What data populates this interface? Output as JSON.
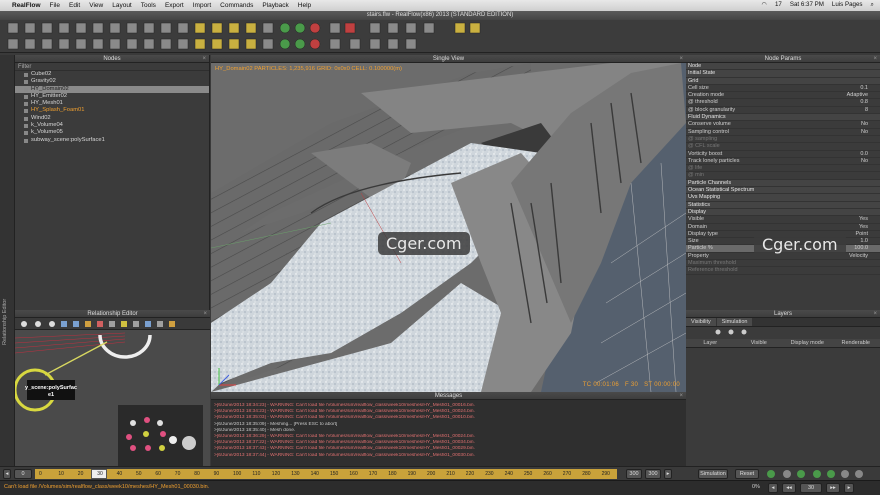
{
  "menubar": {
    "app_name": "RealFlow",
    "items": [
      "File",
      "Edit",
      "View",
      "Layout",
      "Tools",
      "Export",
      "Import",
      "Commands",
      "Playback",
      "Help"
    ],
    "clock": "Sat 6:37 PM",
    "user": "Luis Pages",
    "battery": "17"
  },
  "window": {
    "title": "stairs.flw - RealFlow(x86) 2013 (STANDARD EDITION)"
  },
  "nodes_panel": {
    "title": "Nodes",
    "filter_label": "Filter",
    "items": [
      {
        "label": "Cube02",
        "state": "normal"
      },
      {
        "label": "Gravity02",
        "state": "normal"
      },
      {
        "label": "HY_Domain02",
        "state": "selected"
      },
      {
        "label": "HY_Emitter02",
        "state": "normal"
      },
      {
        "label": "HY_Mesh01",
        "state": "normal"
      },
      {
        "label": "HY_Splash_Foam01",
        "state": "orange"
      },
      {
        "label": "Wind02",
        "state": "normal"
      },
      {
        "label": "k_Volume04",
        "state": "normal"
      },
      {
        "label": "k_Volume05",
        "state": "normal"
      },
      {
        "label": "subway_scene:polySurface1",
        "state": "normal"
      }
    ]
  },
  "side_label": "Relationship Editor",
  "relationship_panel": {
    "title": "Relationship Editor",
    "node_label": "y_scene:polySurfac e1"
  },
  "view_panel": {
    "title": "Single View",
    "stats": "HY_Domain02 PARTICLES: 1,235,916 GRID: 0x0x0 CELL: 0.100000(m)",
    "timecode": "TC 00:01:06",
    "frame": "F 30",
    "step_time": "ST 00:00:00",
    "watermark": "Cger.com"
  },
  "node_params": {
    "title": "Node Params",
    "rows": [
      {
        "label": "Node",
        "value": "",
        "type": "sec"
      },
      {
        "label": "Initial State",
        "value": "",
        "type": "sec"
      },
      {
        "label": "Grid",
        "value": "",
        "type": "sec"
      },
      {
        "label": "Cell size",
        "value": "0.1",
        "type": "row"
      },
      {
        "label": "Creation mode",
        "value": "Adaptive",
        "type": "row"
      },
      {
        "label": "@ threshold",
        "value": "0.8",
        "type": "row"
      },
      {
        "label": "@ block granularity",
        "value": "8",
        "type": "row"
      },
      {
        "label": "Fluid Dynamics",
        "value": "",
        "type": "sec"
      },
      {
        "label": "Conserve volume",
        "value": "No",
        "type": "row"
      },
      {
        "label": "Sampling control",
        "value": "No",
        "type": "row"
      },
      {
        "label": "@ sampling",
        "value": "",
        "type": "dim"
      },
      {
        "label": "@ CFL scale",
        "value": "",
        "type": "dim"
      },
      {
        "label": "Vorticity boost",
        "value": "0.0",
        "type": "row"
      },
      {
        "label": "Track lonely particles",
        "value": "No",
        "type": "row"
      },
      {
        "label": "@ life",
        "value": "",
        "type": "dim"
      },
      {
        "label": "@ min",
        "value": "",
        "type": "dim"
      },
      {
        "label": "Particle Channels",
        "value": "",
        "type": "sec"
      },
      {
        "label": "Ocean Statistical Spectrum",
        "value": "",
        "type": "sec"
      },
      {
        "label": "Uvs Mapping",
        "value": "",
        "type": "sec"
      },
      {
        "label": "Statistics",
        "value": "",
        "type": "sec"
      },
      {
        "label": "Display",
        "value": "",
        "type": "sec"
      },
      {
        "label": "Visible",
        "value": "Yes",
        "type": "row"
      },
      {
        "label": "Domain",
        "value": "Yes",
        "type": "row"
      },
      {
        "label": "Display type",
        "value": "Point",
        "type": "row"
      },
      {
        "label": "Size",
        "value": "1.0",
        "type": "row"
      },
      {
        "label": "Particle %",
        "value": "100.0",
        "type": "hl"
      },
      {
        "label": "Property",
        "value": "Velocity",
        "type": "row"
      },
      {
        "label": "Maximum threshold",
        "value": "",
        "type": "dim"
      },
      {
        "label": "Reference threshold",
        "value": "",
        "type": "dim"
      }
    ]
  },
  "layers_panel": {
    "title": "Layers",
    "tabs": [
      "Visibility",
      "Simulation"
    ],
    "columns": [
      "Layer",
      "Visible",
      "Display mode",
      "Renderable"
    ]
  },
  "messages_panel": {
    "title": "Messages",
    "lines": [
      {
        "text": ">[6/June/2013 18:34:23] - WARNING: Can't load file /Volumes/sim/realflow_class/week10/meshes/HY_Mesh01_00016.bin.",
        "kind": "w"
      },
      {
        "text": ">[6/June/2013 18:34:23] - WARNING: Can't load file /Volumes/sim/realflow_class/week10/meshes/HY_Mesh01_00024.bin.",
        "kind": "w"
      },
      {
        "text": ">[6/June/2013 18:35:03] - WARNING: Can't load file /Volumes/sim/realflow_class/week10/meshes/HY_Mesh01_00010.bin.",
        "kind": "w"
      },
      {
        "text": ">[6/June/2013 18:35:09] - Meshing... [Press ESC to abort]",
        "kind": "n"
      },
      {
        "text": ">[6/June/2013 18:35:40] - Mesh done.",
        "kind": "n"
      },
      {
        "text": ">[6/June/2013 18:36:29] - WARNING: Can't load file /Volumes/sim/realflow_class/week10/meshes/HY_Mesh01_00024.bin.",
        "kind": "w"
      },
      {
        "text": ">[6/June/2013 18:37:22] - WARNING: Can't load file /Volumes/sim/realflow_class/week10/meshes/HY_Mesh01_00034.bin.",
        "kind": "w"
      },
      {
        "text": ">[6/June/2013 18:37:43] - WARNING: Can't load file /Volumes/sim/realflow_class/week10/meshes/HY_Mesh01_00029.bin.",
        "kind": "w"
      },
      {
        "text": ">[6/June/2013 18:37:44] - WARNING: Can't load file /Volumes/sim/realflow_class/week10/meshes/HY_Mesh01_00030.bin.",
        "kind": "w"
      }
    ]
  },
  "timeline": {
    "start": "0",
    "current": "30",
    "end_left": "300",
    "end_right": "300",
    "ticks": [
      "0",
      "10",
      "20",
      "30",
      "40",
      "50",
      "60",
      "70",
      "80",
      "90",
      "100",
      "110",
      "120",
      "130",
      "140",
      "150",
      "160",
      "170",
      "180",
      "190",
      "200",
      "210",
      "220",
      "230",
      "240",
      "250",
      "260",
      "270",
      "280",
      "290"
    ],
    "mode": "Simulation",
    "reset": "Reset",
    "zoom": "0%",
    "frame_field": "30"
  },
  "status": {
    "error": "Can't load file /Volumes/sim/realflow_class/week10/meshes/HY_Mesh01_00030.bin."
  }
}
